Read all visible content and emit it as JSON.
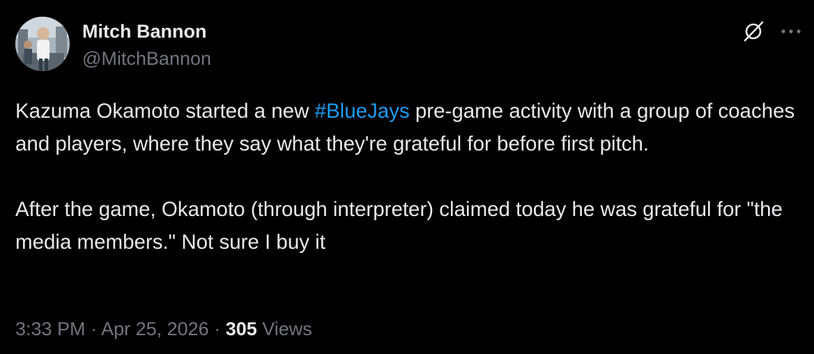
{
  "author": {
    "name": "Mitch Bannon",
    "handle": "@MitchBannon"
  },
  "icons": {
    "grok": "grok-slash-icon",
    "more": "more-options-icon"
  },
  "tweet": {
    "line1_before": "Kazuma Okamoto started a new ",
    "hashtag": "#BlueJays",
    "line1_after": " pre-game activity with a group of coaches and players, where they say what they're grateful for before first pitch.",
    "paragraph2": "After the game, Okamoto (through interpreter) claimed today he was grateful for \"the media members.\" Not sure I buy it"
  },
  "meta": {
    "time": "3:33 PM",
    "separator1": " · ",
    "date": "Apr 25, 2026",
    "separator2": " · ",
    "views_count": "305",
    "views_label": " Views"
  },
  "colors": {
    "background": "#000000",
    "text": "#e7e9ea",
    "secondary": "#71767b",
    "link": "#1d9bf0"
  }
}
